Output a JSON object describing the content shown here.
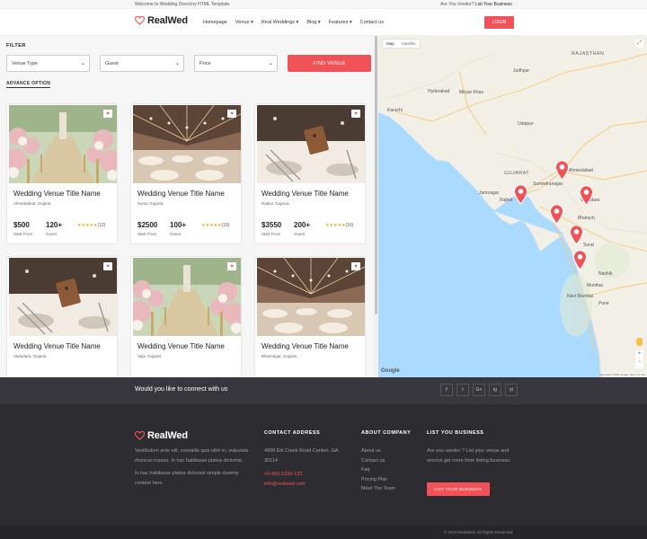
{
  "topbar": {
    "welcome": "Welcome to Wedding Directory HTML Template.",
    "vendor_q": "Are You Vendor?",
    "vendor_link": "List Your Business"
  },
  "header": {
    "logo": "RealWed",
    "nav": [
      "Homepage",
      "Venue",
      "Real Weddings",
      "Blog",
      "Features",
      "Contact us"
    ],
    "nav_dropdown": [
      false,
      true,
      true,
      true,
      true,
      false
    ],
    "login": "LOGIN"
  },
  "filter": {
    "title": "FILTER",
    "venue_type": "Venue Type",
    "guest": "Guest",
    "price": "Price",
    "find": "FIND VENUE",
    "advance": "ADVANCE OPTION"
  },
  "venues": [
    {
      "title": "Wedding Venue Title Name",
      "location": "Ahmedabad, Gujarat.",
      "price": "$500",
      "guests": "120+",
      "rating": "★★★★★",
      "reviews": "(12)",
      "image": "aisle-flowers"
    },
    {
      "title": "Wedding Venue Title Name",
      "location": "Surat, Gujarat.",
      "price": "$2500",
      "guests": "100+",
      "rating": "★★★★★",
      "reviews": "(19)",
      "image": "banquet-hall"
    },
    {
      "title": "Wedding Venue Title Name",
      "location": "Rajkot, Gujarat.",
      "price": "$3550",
      "guests": "200+",
      "rating": "★★★★★",
      "reviews": "(16)",
      "image": "table-setting"
    },
    {
      "title": "Wedding Venue Title Name",
      "location": "Vadodara, Gujarat.",
      "image": "table-setting"
    },
    {
      "title": "Wedding Venue Title Name",
      "location": "Vapi, Gujarat.",
      "image": "aisle-flowers"
    },
    {
      "title": "Wedding Venue Title Name",
      "location": "Bhavnagar, Gujarat.",
      "image": "banquet-hall"
    }
  ],
  "card_labels": {
    "price": "Start From",
    "guest": "Guest"
  },
  "map": {
    "tabs": [
      "Map",
      "Satellite"
    ],
    "labels": [
      "RAJASTHAN",
      "Hyderabad",
      "Mirpur Khas",
      "Jodhpur",
      "Karachi",
      "Udaipur",
      "GUJARAT",
      "Ahmedabad",
      "Surendranagar",
      "Jamnagar",
      "Rajkot",
      "Vadodara",
      "Bharuch",
      "Surat",
      "Nashik",
      "Navi Mumbai",
      "Pune",
      "Mumbai"
    ],
    "google": "Google",
    "attribution": "Map data ©2018 Google  Terms of Use"
  },
  "connect": {
    "text": "Would you like to connect with us",
    "social": [
      "f",
      "t",
      "G+",
      "ig",
      "yt"
    ]
  },
  "footer": {
    "logo": "RealWed",
    "about_1": "Vestibulum ante elit, convallis quis nibh in, vulputate rhoncus massa. In hac habitasse platea dictumst.",
    "about_2": "In hac habitasse platea dictumst simple dummy content here.",
    "contact_head": "CONTACT ADDRESS",
    "address": "4998 Elk Creek Road Canton, GA 30114",
    "phone": "+0-800-1234-123",
    "email": "info@realwed.com",
    "company_head": "ABOUT COMPANY",
    "company_links": [
      "About us",
      "Contact us",
      "Faq",
      "Pricing Plan",
      "Meet The Team"
    ],
    "business_head": "LIST YOU BUSINESS",
    "business_text": "Are you vendor ? List your venue and service get more from listing business.",
    "business_btn": "LIST YOUR BUSINESS",
    "copyright": "© 2018 RealWed. All Rights Reserved."
  },
  "colors": {
    "accent": "#f05258",
    "dark": "#2d2c31",
    "connect": "#38373d"
  }
}
